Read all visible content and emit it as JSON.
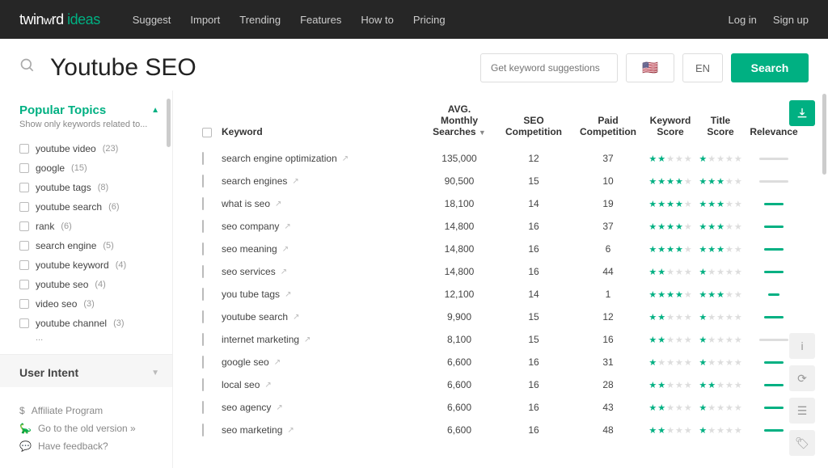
{
  "header": {
    "logo_pre": "twin",
    "logo_bird": "w",
    "logo_mid": "rd ",
    "logo_accent": "ideas",
    "nav": [
      "Suggest",
      "Import",
      "Trending",
      "Features",
      "How to",
      "Pricing"
    ],
    "right": [
      "Log in",
      "Sign up"
    ]
  },
  "search": {
    "query": "Youtube SEO",
    "suggest_placeholder": "Get keyword suggestions",
    "flag": "🇺🇸",
    "lang": "EN",
    "button": "Search"
  },
  "sidebar": {
    "popular": {
      "title": "Popular Topics",
      "sub": "Show only keywords related to...",
      "items": [
        {
          "label": "youtube video",
          "count": "(23)"
        },
        {
          "label": "google",
          "count": "(15)"
        },
        {
          "label": "youtube tags",
          "count": "(8)"
        },
        {
          "label": "youtube search",
          "count": "(6)"
        },
        {
          "label": "rank",
          "count": "(6)"
        },
        {
          "label": "search engine",
          "count": "(5)"
        },
        {
          "label": "youtube keyword",
          "count": "(4)"
        },
        {
          "label": "youtube seo",
          "count": "(4)"
        },
        {
          "label": "video seo",
          "count": "(3)"
        },
        {
          "label": "youtube channel",
          "count": "(3)"
        }
      ],
      "more": "..."
    },
    "intent_title": "User Intent",
    "footer": {
      "affiliate": "Affiliate Program",
      "old": "Go to the old version »",
      "feedback": "Have feedback?"
    }
  },
  "table": {
    "headers": {
      "keyword": "Keyword",
      "avg_line1": "AVG.",
      "avg_line2": "Monthly Searches",
      "seo_line1": "SEO",
      "seo_line2": "Competition",
      "paid_line1": "Paid",
      "paid_line2": "Competition",
      "kw_score_line1": "Keyword",
      "kw_score_line2": "Score",
      "title_score_line1": "Title",
      "title_score_line2": "Score",
      "relevance": "Relevance"
    },
    "rows": [
      {
        "kw": "search engine optimization",
        "searches": "135,000",
        "seo": "12",
        "paid": "37",
        "ks": 2,
        "ts": 1,
        "rel": "gray"
      },
      {
        "kw": "search engines",
        "searches": "90,500",
        "seo": "15",
        "paid": "10",
        "ks": 4,
        "ts": 3,
        "rel": "gray"
      },
      {
        "kw": "what is seo",
        "searches": "18,100",
        "seo": "14",
        "paid": "19",
        "ks": 4,
        "ts": 3,
        "rel": "green"
      },
      {
        "kw": "seo company",
        "searches": "14,800",
        "seo": "16",
        "paid": "37",
        "ks": 4,
        "ts": 3,
        "rel": "green"
      },
      {
        "kw": "seo meaning",
        "searches": "14,800",
        "seo": "16",
        "paid": "6",
        "ks": 4,
        "ts": 3,
        "rel": "green"
      },
      {
        "kw": "seo services",
        "searches": "14,800",
        "seo": "16",
        "paid": "44",
        "ks": 2,
        "ts": 1,
        "rel": "green"
      },
      {
        "kw": "you tube tags",
        "searches": "12,100",
        "seo": "14",
        "paid": "1",
        "ks": 4,
        "ts": 3,
        "rel": "green-s"
      },
      {
        "kw": "youtube search",
        "searches": "9,900",
        "seo": "15",
        "paid": "12",
        "ks": 2,
        "ts": 1,
        "rel": "green"
      },
      {
        "kw": "internet marketing",
        "searches": "8,100",
        "seo": "15",
        "paid": "16",
        "ks": 2,
        "ts": 1,
        "rel": "gray"
      },
      {
        "kw": "google seo",
        "searches": "6,600",
        "seo": "16",
        "paid": "31",
        "ks": 1,
        "ts": 1,
        "rel": "green"
      },
      {
        "kw": "local seo",
        "searches": "6,600",
        "seo": "16",
        "paid": "28",
        "ks": 2,
        "ts": 2,
        "rel": "green"
      },
      {
        "kw": "seo agency",
        "searches": "6,600",
        "seo": "16",
        "paid": "43",
        "ks": 2,
        "ts": 1,
        "rel": "green"
      },
      {
        "kw": "seo marketing",
        "searches": "6,600",
        "seo": "16",
        "paid": "48",
        "ks": 2,
        "ts": 1,
        "rel": "green"
      }
    ]
  }
}
